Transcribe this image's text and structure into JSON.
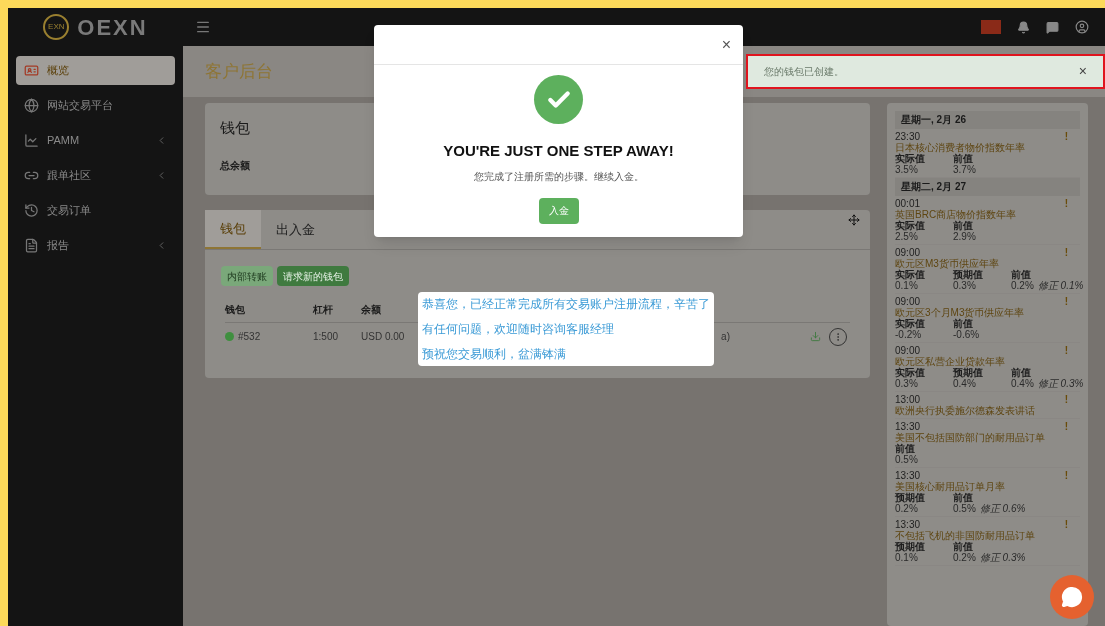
{
  "brand": {
    "name": "OEXN",
    "emblem": "EXN"
  },
  "sidebar": {
    "items": [
      {
        "label": "概览",
        "selected": true,
        "has_submenu": false
      },
      {
        "label": "网站交易平台",
        "selected": false,
        "has_submenu": false
      },
      {
        "label": "PAMM",
        "selected": false,
        "has_submenu": true
      },
      {
        "label": "跟单社区",
        "selected": false,
        "has_submenu": true
      },
      {
        "label": "交易订单",
        "selected": false,
        "has_submenu": false
      },
      {
        "label": "报告",
        "selected": false,
        "has_submenu": true
      }
    ]
  },
  "page_title": "客户后台",
  "wallet_card": {
    "title": "钱包",
    "total_label": "总余额"
  },
  "tabs": [
    {
      "label": "钱包",
      "selected": true
    },
    {
      "label": "出入金",
      "selected": false
    }
  ],
  "buttons": [
    {
      "label": "内部转账",
      "disabled": true
    },
    {
      "label": "请求新的钱包",
      "disabled": false
    }
  ],
  "table": {
    "columns": [
      "钱包",
      "杠杆",
      "余额"
    ],
    "rows": [
      {
        "color": "#3f8f3f",
        "wallet": "#532",
        "leverage": "1:500",
        "balance": "USD 0.00",
        "column_4": "a)"
      }
    ]
  },
  "toast": {
    "message": "您的钱包已创建。",
    "close": "×"
  },
  "modal": {
    "close": "×",
    "title": "YOU'RE JUST ONE STEP AWAY!",
    "message": "您完成了注册所需的步骤。继续入金。",
    "button": "入金"
  },
  "annotation": {
    "lines": [
      "恭喜您，已经正常完成所有交易账户注册流程，辛苦了",
      "有任何问题，欢迎随时咨询客服经理",
      "预祝您交易顺利，盆满钵满"
    ]
  },
  "calendar": {
    "days": [
      {
        "date": "星期一, 2月 26",
        "events": [
          {
            "time": "23:30",
            "mark": "!",
            "title": "日本核心消费者物价指数年率",
            "figures": [
              {
                "label": "实际值",
                "value": "3.5%"
              },
              {
                "label": "前值",
                "value": "3.7%"
              }
            ]
          }
        ]
      },
      {
        "date": "星期二, 2月 27",
        "events": [
          {
            "time": "00:01",
            "mark": "!",
            "title": "英国BRC商店物价指数年率",
            "figures": [
              {
                "label": "实际值",
                "value": "2.5%"
              },
              {
                "label": "前值",
                "value": "2.9%"
              }
            ]
          },
          {
            "time": "09:00",
            "mark": "!",
            "title": "欧元区M3货币供应年率",
            "figures": [
              {
                "label": "实际值",
                "value": "0.1%"
              },
              {
                "label": "预期值",
                "value": "0.3%"
              },
              {
                "label": "前值",
                "value": "0.2%",
                "revised": "修正 0.1%"
              }
            ]
          },
          {
            "time": "09:00",
            "mark": "!",
            "title": "欧元区3个月M3货币供应年率",
            "figures": [
              {
                "label": "实际值",
                "value": "-0.2%"
              },
              {
                "label": "前值",
                "value": "-0.6%"
              }
            ]
          },
          {
            "time": "09:00",
            "mark": "!",
            "title": "欧元区私营企业贷款年率",
            "figures": [
              {
                "label": "实际值",
                "value": "0.3%"
              },
              {
                "label": "预期值",
                "value": "0.4%"
              },
              {
                "label": "前值",
                "value": "0.4%",
                "revised": "修正 0.3%"
              }
            ]
          },
          {
            "time": "13:00",
            "mark": "!",
            "title": "欧洲央行执委施尔德森发表讲话"
          },
          {
            "time": "13:30",
            "mark": "!",
            "title": "美国不包括国防部门的耐用品订单",
            "figures": [
              {
                "label": "前值",
                "value": "0.5%"
              }
            ]
          },
          {
            "time": "13:30",
            "mark": "!",
            "title": "美国核心耐用品订单月率",
            "figures": [
              {
                "label": "预期值",
                "value": "0.2%"
              },
              {
                "label": "前值",
                "value": "0.5%",
                "revised": "修正 0.6%"
              }
            ]
          },
          {
            "time": "13:30",
            "mark": "!",
            "title": "不包括飞机的非国防耐用品订单",
            "figures": [
              {
                "label": "预期值",
                "value": "0.1%"
              },
              {
                "label": "前值",
                "value": "0.2%",
                "revised": "修正 0.3%"
              }
            ]
          }
        ]
      }
    ]
  }
}
